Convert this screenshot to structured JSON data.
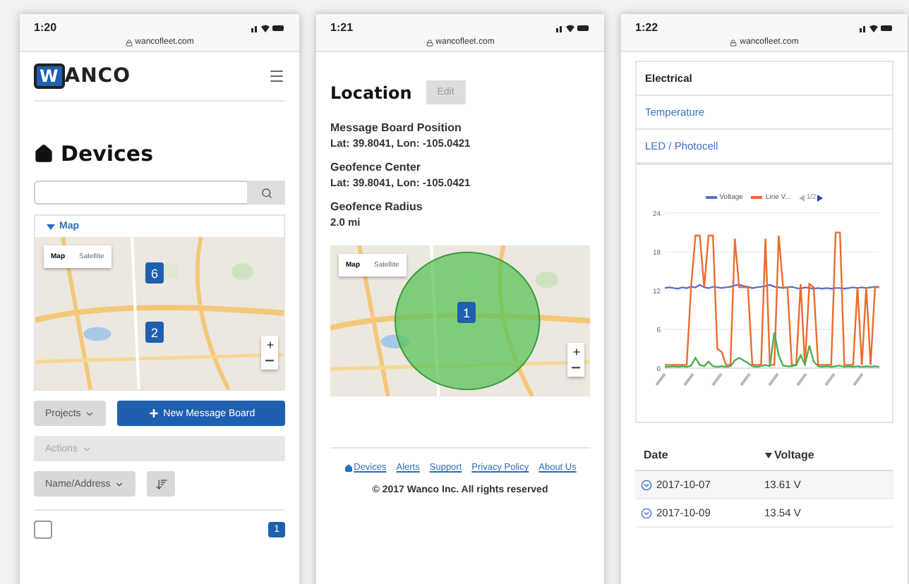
{
  "screens": [
    {
      "kind": "devices",
      "status": {
        "time": "1:20",
        "url": "wancofleet.com"
      },
      "logo": {
        "mark": "W",
        "text": "ANCO"
      },
      "title": "Devices",
      "map_panel": {
        "label": "Map",
        "expanded": true,
        "map_types": [
          {
            "label": "Map",
            "selected": true
          },
          {
            "label": "Satellite",
            "selected": false
          }
        ],
        "markers": [
          "6",
          "2"
        ]
      },
      "projects_button": {
        "label": "Projects"
      },
      "new_button": {
        "label": "New Message Board"
      },
      "actions_button": {
        "label": "Actions",
        "disabled": true
      },
      "sort_select": {
        "label": "Name/Address"
      },
      "row_checkbox": {
        "checked": false
      },
      "page_badge": "1"
    },
    {
      "kind": "location",
      "status": {
        "time": "1:21",
        "url": "wancofleet.com"
      },
      "title": "Location",
      "edit_button": {
        "label": "Edit",
        "disabled": true
      },
      "fields": [
        {
          "label": "Message Board Position",
          "value": "Lat: 39.8041, Lon: -105.0421"
        },
        {
          "label": "Geofence Center",
          "value": "Lat: 39.8041, Lon: -105.0421"
        },
        {
          "label": "Geofence Radius",
          "value": "2.0 mi"
        }
      ],
      "map": {
        "map_types": [
          {
            "label": "Map",
            "selected": true
          },
          {
            "label": "Satellite",
            "selected": false
          }
        ],
        "marker": "1"
      },
      "footer_links": [
        {
          "label": "Devices",
          "kind": "home"
        },
        {
          "label": "Alerts",
          "kind": "plain"
        },
        {
          "label": "Support",
          "kind": "plain"
        },
        {
          "label": "Privacy Policy",
          "kind": "plain"
        },
        {
          "label": "About Us",
          "kind": "plain"
        }
      ],
      "copyright": "© 2017 Wanco Inc. All rights reserved"
    },
    {
      "kind": "electrical",
      "status": {
        "time": "1:22",
        "url": "wancofleet.com"
      },
      "tabs": [
        {
          "label": "Electrical",
          "selected": true
        },
        {
          "label": "Temperature",
          "selected": false
        },
        {
          "label": "LED / Photocell",
          "selected": false
        }
      ],
      "legend_pager": "1/2",
      "chart_data": {
        "type": "line",
        "grid": true,
        "ylim": [
          0,
          24
        ],
        "yticks": [
          0,
          6,
          12,
          18,
          24
        ],
        "series": [
          {
            "name": "Voltage",
            "color": "#5b6fd6",
            "values": [
              12.4,
              12.5,
              12.4,
              12.3,
              12.5,
              12.4,
              12.6,
              12.5,
              12.9,
              12.5,
              12.4,
              12.6,
              12.5,
              12.4,
              12.5,
              12.6,
              12.8,
              12.9,
              12.7,
              12.6,
              12.4,
              12.5,
              12.6,
              12.7,
              12.9,
              12.6,
              12.5,
              12.4,
              12.5,
              12.6,
              12.4,
              12.3,
              12.5,
              12.4,
              12.3,
              12.4,
              12.3,
              12.4,
              12.3,
              12.4,
              12.4,
              12.3,
              12.4,
              12.5,
              12.4,
              12.5,
              12.4,
              12.5,
              12.6,
              12.6
            ]
          },
          {
            "name": "Line V...",
            "color": "#ee6a2c",
            "values": [
              0.5,
              0.5,
              0.5,
              0.5,
              0.5,
              0.5,
              12.5,
              20.5,
              20.5,
              12.5,
              20.5,
              20.5,
              3,
              2.5,
              0.5,
              0.5,
              20,
              12.5,
              12.5,
              12.5,
              0.5,
              0.5,
              0.5,
              20,
              0.5,
              0.5,
              20.5,
              12.5,
              12.5,
              0.5,
              0.5,
              13,
              0.5,
              13,
              12.5,
              0.5,
              0.5,
              0.5,
              0.5,
              21,
              21,
              0.5,
              0.5,
              0.5,
              12.5,
              0.5,
              12.5,
              0.5,
              12.5,
              12.5
            ]
          },
          {
            "color": "#4caf50",
            "values": [
              0.2,
              0.2,
              0.3,
              0.2,
              0.3,
              0.2,
              0.4,
              1.6,
              0.5,
              0.3,
              1,
              0.3,
              0.2,
              0.3,
              0.2,
              0.3,
              1.2,
              1.6,
              1.2,
              0.8,
              0.3,
              0.2,
              0.3,
              0.5,
              0.3,
              5.5,
              2,
              0.4,
              0.3,
              0.3,
              0.5,
              2,
              0.6,
              3.5,
              1,
              0.3,
              0.2,
              0.3,
              0.2,
              0.3,
              0.4,
              0.2,
              0.3,
              0.2,
              0.3,
              0.2,
              0.3,
              0.2,
              0.3,
              0.2
            ]
          }
        ]
      },
      "table": {
        "columns": [
          {
            "label": "Date",
            "sorted": false
          },
          {
            "label": "Voltage",
            "sorted": true
          }
        ],
        "rows": [
          {
            "date": "2017-10-07",
            "voltage": "13.61 V"
          },
          {
            "date": "2017-10-09",
            "voltage": "13.54 V"
          }
        ]
      }
    }
  ]
}
